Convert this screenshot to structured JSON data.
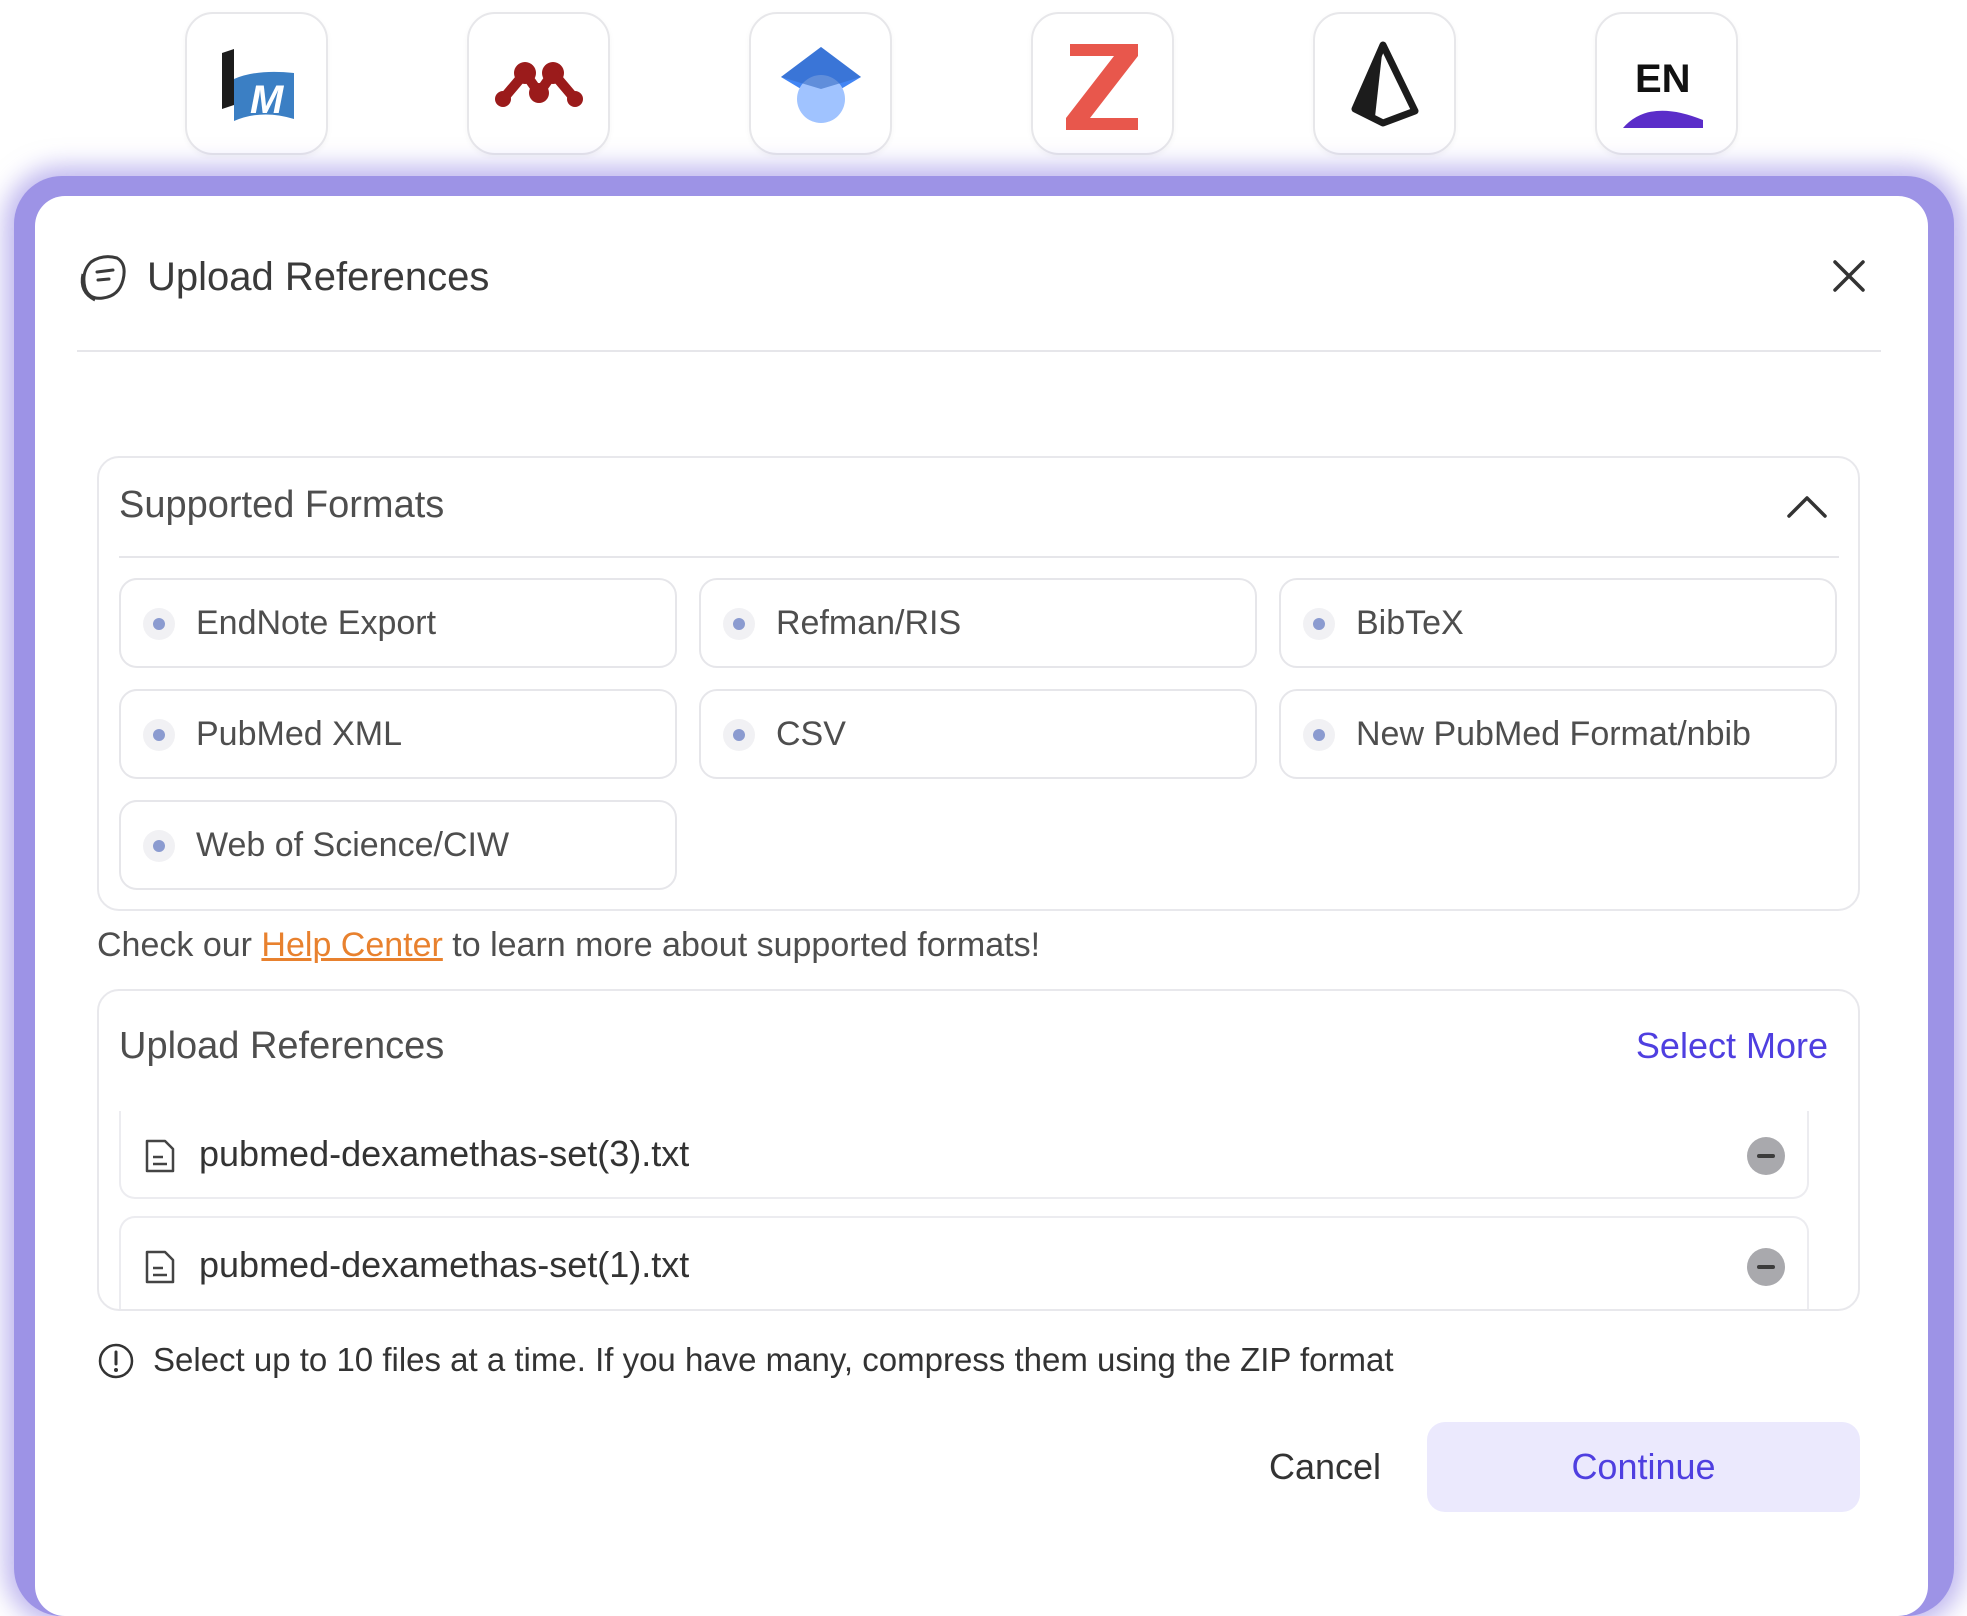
{
  "apps": [
    {
      "name": "mendeley-style-library-icon"
    },
    {
      "name": "mendeley-icon"
    },
    {
      "name": "google-scholar-icon"
    },
    {
      "name": "zotero-icon",
      "glyph": "Z"
    },
    {
      "name": "paperpile-icon"
    },
    {
      "name": "endnote-icon",
      "glyph": "EN"
    }
  ],
  "modal": {
    "title": "Upload References"
  },
  "formats": {
    "title": "Supported Formats",
    "items": [
      "EndNote Export",
      "Refman/RIS",
      "BibTeX",
      "PubMed XML",
      "CSV",
      "New PubMed Format/nbib",
      "Web of Science/CIW"
    ]
  },
  "help": {
    "prefix": "Check our",
    "link": "Help Center",
    "suffix": "to learn more about supported formats!"
  },
  "upload": {
    "title": "Upload References",
    "select_more": "Select More",
    "files": [
      "pubmed-dexamethas-set(3).txt",
      "pubmed-dexamethas-set(1).txt"
    ]
  },
  "note": "Select up to 10 files at a time. If you have many, compress them using the ZIP format",
  "actions": {
    "cancel": "Cancel",
    "continue": "Continue"
  },
  "colors": {
    "accent": "#4f3fe0",
    "link": "#e8812e",
    "glow": "#9d93e6",
    "continue_bg": "#ebe9fd"
  }
}
